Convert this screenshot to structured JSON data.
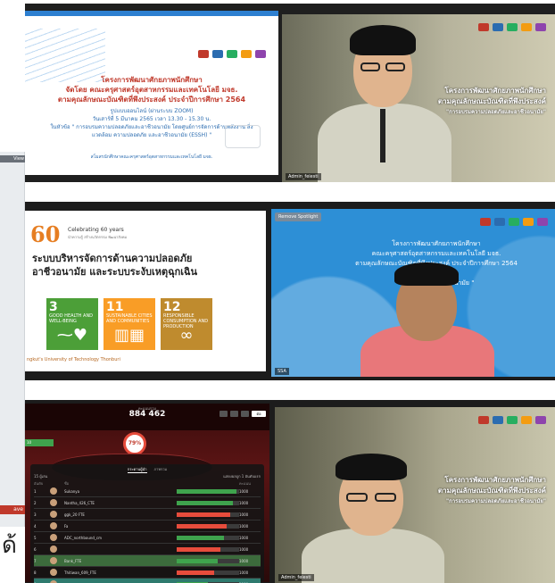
{
  "sidebar": {
    "tag": "View",
    "red_label": "ave",
    "glyph": "ด้"
  },
  "logos": [
    {
      "color": "#c0392b"
    },
    {
      "color": "#2b6cb0"
    },
    {
      "color": "#27ae60"
    },
    {
      "color": "#f39c12"
    },
    {
      "color": "#8e44ad"
    },
    {
      "color": "#16a085"
    }
  ],
  "tile1": {
    "slide": {
      "title_lines": [
        "โครงการพัฒนาศักยภาพนักศึกษา",
        "จัดโดย คณะครุศาสตร์อุตสาหกรรมและเทคโนโลยี มจธ.",
        "ตามคุณลักษณะบัณฑิตที่พึงประสงค์ ประจำปีการศึกษา 2564"
      ],
      "format": "รูปแบบออนไลน์ (ผ่านระบบ ZOOM)",
      "date": "วันเสาร์ที่ 5 มีนาคม 2565 เวลา 13.30 - 15.30 น.",
      "topic": "ในหัวข้อ \" การอบรมความปลอดภัยและอาชีวอนามัย โดยศูนย์การจัดการด้านพลังงาน สิ่งแวดล้อม ความปลอดภัย และอาชีวอนามัย (ESSH) \"",
      "footer": "สโมสรนักศึกษาคณะครุศาสตร์อุตสาหกรรมและเทคโนโลยี มจธ."
    },
    "camera": {
      "banner_line1": "โครงการพัฒนาศักยภาพนักศึกษา",
      "banner_line2": "ตามคุณลักษณะบัณฑิตที่พึงประสงค์",
      "banner_line3": "\"การอบรมความปลอดภัยและอาชีวอนามัย\"",
      "name": "Admin_feiesti"
    }
  },
  "tile2": {
    "slide": {
      "sixty": "60",
      "celebrating": "Celebrating 60 years",
      "celebrating_sub": "นำความรู้ สร้างนวัตกรรม พัฒนาสังคม",
      "heading_line1": "ระบบบริหารจัดการด้านความปลอดภัย",
      "heading_line2": "อาชีวอนามัย และระบบระงับเหตุฉุกเฉิน",
      "sdgs": [
        {
          "num": "3",
          "text": "GOOD HEALTH AND WELL-BEING",
          "color": "#4c9f38",
          "icon": "heartbeat-icon",
          "glyph": "⁓♥"
        },
        {
          "num": "11",
          "text": "SUSTAINABLE CITIES AND COMMUNITIES",
          "color": "#f99d26",
          "icon": "city-icon",
          "glyph": "▥▦"
        },
        {
          "num": "12",
          "text": "RESPONSIBLE CONSUMPTION AND PRODUCTION",
          "color": "#bf8b2e",
          "icon": "infinity-icon",
          "glyph": "∞"
        }
      ],
      "university": "ngkut's University of Technology Thonburi"
    },
    "camera": {
      "spotlight": "Remove Spotlight",
      "line1": "โครงการพัฒนาศักยภาพนักศึกษา",
      "line2": "คณะครุศาสตร์อุตสาหกรรมและเทคโนโลยี มจธ.",
      "line3": "ตามคุณลักษณะบัณฑิตที่พึงประสงค์ ประจำปีการศึกษา 2564",
      "line4": "ในหัวข้อ",
      "line5": "\" การอบรมควา                    ชีวอนามัย \"",
      "name": "SSA"
    }
  },
  "tile3": {
    "game": {
      "score_label": "คะแนนรวม",
      "score": "884 462",
      "next": "ต่อ",
      "percent": "79%",
      "green_label": "10",
      "tabs": [
        "กระดานผู้นำ",
        "ภาพรวม"
      ],
      "tool_left": "15 ผู้เล่น",
      "tool_right": "แสดงผลถูก 1 อันดับแรก",
      "columns": [
        "อันดับ",
        "",
        "ชื่อ",
        "",
        "คะแนน"
      ],
      "rows": [
        {
          "rank": "1",
          "name": "Sukanya",
          "score": "1000",
          "pct": 0.95,
          "color": "#3fa34d"
        },
        {
          "rank": "2",
          "name": "Nantha_426_CTE",
          "score": "1000",
          "pct": 0.9,
          "color": "#3fa34d"
        },
        {
          "rank": "3",
          "name": "ggk_20 FTE",
          "score": "1000",
          "pct": 0.85,
          "color": "#e74c3c"
        },
        {
          "rank": "4",
          "name": "Fa",
          "score": "1000",
          "pct": 0.8,
          "color": "#e74c3c"
        },
        {
          "rank": "5",
          "name": "ADC_northbound_cm",
          "score": "1000",
          "pct": 0.75,
          "color": "#3fa34d"
        },
        {
          "rank": "6",
          "name": "",
          "score": "1000",
          "pct": 0.7,
          "color": "#e74c3c"
        },
        {
          "rank": "7",
          "name": "Bank_FTE",
          "score": "1000",
          "pct": 0.65,
          "color": "#3fa34d"
        },
        {
          "rank": "8",
          "name": "Thitiwan_609_FTE",
          "score": "1000",
          "pct": 0.6,
          "color": "#e74c3c"
        },
        {
          "rank": "9",
          "name": "",
          "score": "1000",
          "pct": 0.5,
          "color": "#3fa34d"
        }
      ]
    },
    "camera": {
      "banner_line1": "โครงการพัฒนาศักยภาพนักศึกษา",
      "banner_line2": "ตามคุณลักษณะบัณฑิตที่พึงประสงค์",
      "banner_line3": "\"การอบรมความปลอดภัยและอาชีวอนามัย\"",
      "name": "Admin_feiesti"
    }
  }
}
